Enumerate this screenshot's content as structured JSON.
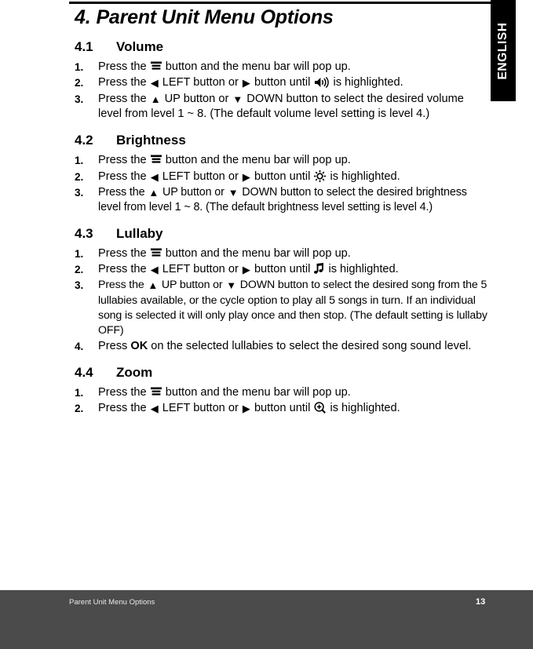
{
  "document": {
    "language_tab": "ENGLISH",
    "chapter_number": "4.",
    "chapter_title": "Parent Unit Menu Options"
  },
  "sections": [
    {
      "number": "4.1",
      "title": "Volume",
      "steps": [
        {
          "marker": "1.",
          "parts": [
            {
              "type": "text",
              "text": "Press the "
            },
            {
              "type": "icon",
              "icon": "menu-icon"
            },
            {
              "type": "text",
              "text": " button and the menu bar will pop up."
            }
          ]
        },
        {
          "marker": "2.",
          "parts": [
            {
              "type": "text",
              "text": "Press the "
            },
            {
              "type": "glyph",
              "glyph": "◀",
              "icon": "left-arrow-icon"
            },
            {
              "type": "text",
              "text": " LEFT button or "
            },
            {
              "type": "glyph",
              "glyph": "▶",
              "icon": "right-arrow-icon"
            },
            {
              "type": "text",
              "text": " button until "
            },
            {
              "type": "icon",
              "icon": "speaker-volume-icon"
            },
            {
              "type": "text",
              "text": " is highlighted."
            }
          ]
        },
        {
          "marker": "3.",
          "parts": [
            {
              "type": "text",
              "text": "Press the "
            },
            {
              "type": "glyph",
              "glyph": "▲",
              "icon": "up-arrow-icon"
            },
            {
              "type": "text",
              "text": " UP button or "
            },
            {
              "type": "glyph",
              "glyph": "▼",
              "icon": "down-arrow-icon"
            },
            {
              "type": "text",
              "text": " DOWN button to select the desired volume level from level 1 ~ 8. (The default volume level setting is level 4.)"
            }
          ]
        }
      ]
    },
    {
      "number": "4.2",
      "title": "Brightness",
      "steps": [
        {
          "marker": "1.",
          "parts": [
            {
              "type": "text",
              "text": "Press the "
            },
            {
              "type": "icon",
              "icon": "menu-icon"
            },
            {
              "type": "text",
              "text": " button and the menu bar will pop up."
            }
          ]
        },
        {
          "marker": "2.",
          "parts": [
            {
              "type": "text",
              "text": "Press the "
            },
            {
              "type": "glyph",
              "glyph": "◀",
              "icon": "left-arrow-icon"
            },
            {
              "type": "text",
              "text": " LEFT button or "
            },
            {
              "type": "glyph",
              "glyph": "▶",
              "icon": "right-arrow-icon"
            },
            {
              "type": "text",
              "text": " button until "
            },
            {
              "type": "icon",
              "icon": "brightness-sun-icon"
            },
            {
              "type": "text",
              "text": " is highlighted."
            }
          ]
        },
        {
          "marker": "3.",
          "tight": "tight2",
          "parts": [
            {
              "type": "text",
              "text": "Press the "
            },
            {
              "type": "glyph",
              "glyph": "▲",
              "icon": "up-arrow-icon"
            },
            {
              "type": "text",
              "text": " UP button or "
            },
            {
              "type": "glyph",
              "glyph": "▼",
              "icon": "down-arrow-icon"
            },
            {
              "type": "text",
              "text": " DOWN button to select the desired brightness level from level 1 ~ 8. (The default brightness level setting is level 4.)"
            }
          ]
        }
      ]
    },
    {
      "number": "4.3",
      "title": "Lullaby",
      "steps": [
        {
          "marker": "1.",
          "parts": [
            {
              "type": "text",
              "text": "Press the "
            },
            {
              "type": "icon",
              "icon": "menu-icon"
            },
            {
              "type": "text",
              "text": " button and the menu bar will pop up."
            }
          ]
        },
        {
          "marker": "2.",
          "parts": [
            {
              "type": "text",
              "text": "Press the "
            },
            {
              "type": "glyph",
              "glyph": "◀",
              "icon": "left-arrow-icon"
            },
            {
              "type": "text",
              "text": " LEFT button or "
            },
            {
              "type": "glyph",
              "glyph": "▶",
              "icon": "right-arrow-icon"
            },
            {
              "type": "text",
              "text": " button until "
            },
            {
              "type": "icon",
              "icon": "music-note-icon"
            },
            {
              "type": "text",
              "text": " is highlighted."
            }
          ]
        },
        {
          "marker": "3.",
          "tight": "tight",
          "parts": [
            {
              "type": "text",
              "text": "Press the "
            },
            {
              "type": "glyph",
              "glyph": "▲",
              "icon": "up-arrow-icon"
            },
            {
              "type": "text",
              "text": " UP button or "
            },
            {
              "type": "glyph",
              "glyph": "▼",
              "icon": "down-arrow-icon"
            },
            {
              "type": "text",
              "text": " DOWN button to select the desired song from the 5 lullabies available, or the cycle option to play all 5 songs in turn. If an individual song is selected it will only play once and then stop. (The default setting is lullaby OFF)"
            }
          ]
        },
        {
          "marker": "4.",
          "parts": [
            {
              "type": "text",
              "text": "Press "
            },
            {
              "type": "bold",
              "text": "OK"
            },
            {
              "type": "text",
              "text": " on the selected lullabies to select the desired song sound level."
            }
          ]
        }
      ]
    },
    {
      "number": "4.4",
      "title": "Zoom",
      "steps": [
        {
          "marker": "1.",
          "parts": [
            {
              "type": "text",
              "text": "Press the "
            },
            {
              "type": "icon",
              "icon": "menu-icon"
            },
            {
              "type": "text",
              "text": " button and the menu bar will pop up."
            }
          ]
        },
        {
          "marker": "2.",
          "parts": [
            {
              "type": "text",
              "text": "Press the "
            },
            {
              "type": "glyph",
              "glyph": "◀",
              "icon": "left-arrow-icon"
            },
            {
              "type": "text",
              "text": " LEFT button or "
            },
            {
              "type": "glyph",
              "glyph": "▶",
              "icon": "right-arrow-icon"
            },
            {
              "type": "text",
              "text": " button until "
            },
            {
              "type": "icon",
              "icon": "zoom-in-magnifier-icon"
            },
            {
              "type": "text",
              "text": " is highlighted."
            }
          ]
        }
      ]
    }
  ],
  "footer": {
    "title": "Parent Unit Menu Options",
    "page_number": "13"
  },
  "colors": {
    "text": "#000000",
    "page_background": "#ffffff",
    "footer_background": "#4b4b4b",
    "footer_text": "#e8e8e8",
    "tab_background": "#000000",
    "tab_text": "#ffffff"
  }
}
